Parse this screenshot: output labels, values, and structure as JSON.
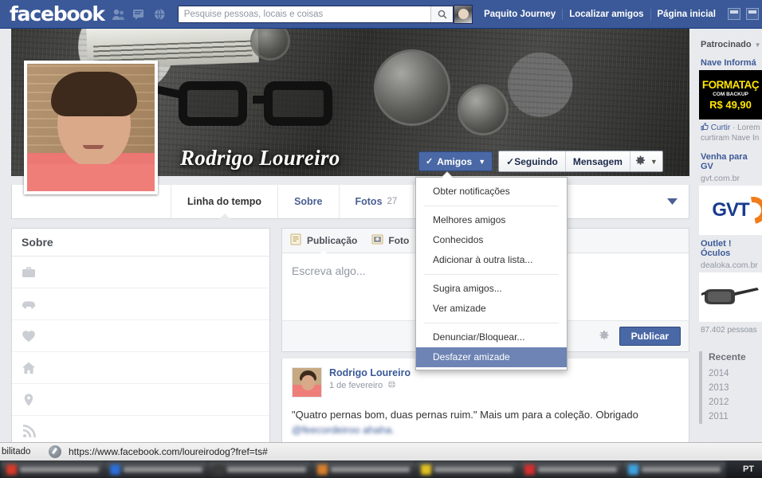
{
  "header": {
    "logo": "facebook",
    "icons": [
      "friend-requests-icon",
      "messages-icon",
      "notifications-icon"
    ],
    "search": {
      "placeholder": "Pesquise pessoas, locais e coisas",
      "value": "",
      "button_icon": "search-icon"
    },
    "user_name": "Paquito Journey",
    "links": [
      "Localizar amigos",
      "Página inicial"
    ]
  },
  "cover": {
    "profile_name": "Rodrigo Loureiro",
    "actions": {
      "friends_label": "Amigos",
      "friends_check": "✓",
      "following_label": "Seguindo",
      "following_check": "✓",
      "message_label": "Mensagem",
      "gear_icon": "gear-icon"
    }
  },
  "tabs": [
    {
      "label": "Linha do tempo",
      "count": "",
      "active": true
    },
    {
      "label": "Sobre",
      "count": "",
      "active": false
    },
    {
      "label": "Fotos",
      "count": "27",
      "active": false
    }
  ],
  "tab_more_icon": "chevron-down-icon",
  "friends_menu": {
    "items": [
      {
        "label": "Obter notificações",
        "selected": false,
        "divider_after": true
      },
      {
        "label": "Melhores amigos",
        "selected": false,
        "divider_after": false
      },
      {
        "label": "Conhecidos",
        "selected": false,
        "divider_after": false
      },
      {
        "label": "Adicionar à outra lista...",
        "selected": false,
        "divider_after": true
      },
      {
        "label": "Sugira amigos...",
        "selected": false,
        "divider_after": false
      },
      {
        "label": "Ver amizade",
        "selected": false,
        "divider_after": true
      },
      {
        "label": "Denunciar/Bloquear...",
        "selected": false,
        "divider_after": false
      },
      {
        "label": "Desfazer amizade",
        "selected": true,
        "divider_after": false
      }
    ]
  },
  "about_card": {
    "title": "Sobre",
    "rows": [
      {
        "icon": "briefcase-icon",
        "redacted": true,
        "lines": 2
      },
      {
        "icon": "graduation-icon",
        "redacted": true,
        "lines": 2
      },
      {
        "icon": "heart-icon",
        "redacted": true,
        "lines": 2
      },
      {
        "icon": "home-icon",
        "redacted": true,
        "lines": 1
      },
      {
        "icon": "location-pin-icon",
        "redacted": true,
        "lines": 1
      },
      {
        "icon": "rss-icon",
        "redacted": true,
        "lines": 1
      }
    ]
  },
  "composer": {
    "tabs": [
      {
        "label": "Publicação",
        "icon": "status-note-icon",
        "active": true
      },
      {
        "label": "Foto",
        "icon": "photo-icon",
        "active": false
      }
    ],
    "placeholder": "Escreva algo...",
    "gear_icon": "gear-icon",
    "publish_label": "Publicar"
  },
  "post": {
    "author": "Rodrigo Loureiro",
    "date": "1 de fevereiro",
    "privacy_icon": "globe-icon",
    "text": "\"Quatro pernas bom, duas pernas ruim.\" Mais um para a coleção. Obrigado ",
    "mention": "@feecordeiroo ahaha."
  },
  "right_column": {
    "sponsored_label": "Patrocinado",
    "sponsored_caret": "▼",
    "ads": [
      {
        "title": "Nave Informá",
        "url": "",
        "image": "formatacao-banner",
        "image_lines": [
          "FORMATAÇ",
          "COM BACKUP",
          "R$ 49,90"
        ],
        "meta_like": "Curtir",
        "meta_rest": " · Lorem",
        "meta_line2": "curtiram Nave In"
      },
      {
        "title": "Venha para GV",
        "url": "gvt.com.br",
        "image": "gvt-logo",
        "image_text": "GVT"
      },
      {
        "title": "Outlet ! Óculos",
        "url": "dealoka.com.br",
        "image": "sunglasses-photo",
        "meta_line": "87.402 pessoas"
      }
    ],
    "recent": {
      "title": "Recente",
      "years": [
        "2014",
        "2013",
        "2012",
        "2011"
      ]
    }
  },
  "statusbar": {
    "left_text": "bilitado",
    "shield_icon": "security-shield-icon",
    "url": "https://www.facebook.com/loureirodog?fref=ts#"
  },
  "taskbar": {
    "language": "PT"
  }
}
